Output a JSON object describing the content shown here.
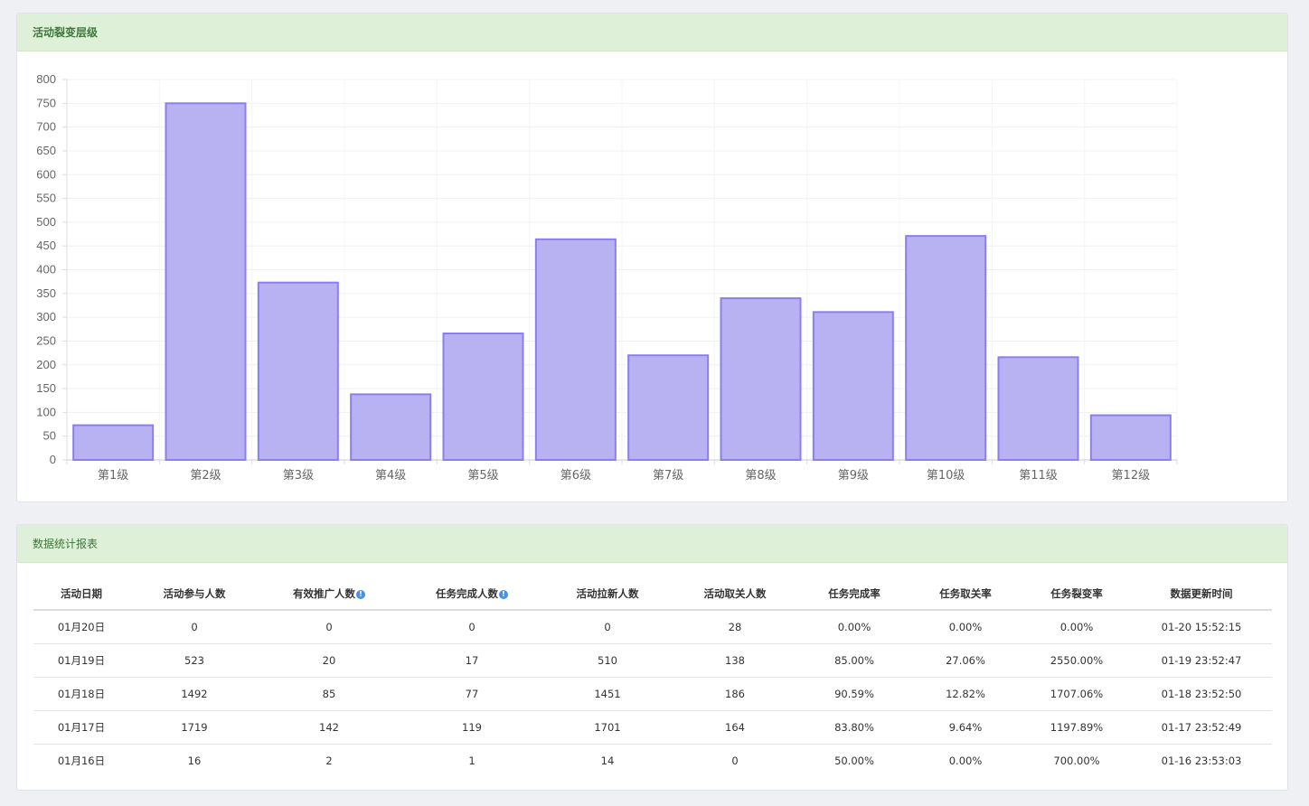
{
  "chart_panel": {
    "title": "活动裂变层级"
  },
  "table_panel": {
    "title": "数据统计报表"
  },
  "chart_data": {
    "type": "bar",
    "title": "",
    "xlabel": "",
    "ylabel": "",
    "categories": [
      "第1级",
      "第2级",
      "第3级",
      "第4级",
      "第5级",
      "第6级",
      "第7级",
      "第8级",
      "第9级",
      "第10级",
      "第11级",
      "第12级"
    ],
    "series": [
      {
        "values": [
          73,
          750,
          373,
          138,
          266,
          464,
          220,
          340,
          311,
          471,
          216,
          94
        ]
      }
    ],
    "ylim": [
      0,
      800
    ],
    "yticks": [
      0,
      50,
      100,
      150,
      200,
      250,
      300,
      350,
      400,
      450,
      500,
      550,
      600,
      650,
      700,
      750,
      800
    ],
    "grid": true,
    "colors": {
      "bar_fill": "#b8b2f3",
      "bar_stroke": "#8b7ff0"
    }
  },
  "table": {
    "headers": [
      {
        "label": "活动日期",
        "info": false
      },
      {
        "label": "活动参与人数",
        "info": false
      },
      {
        "label": "有效推广人数",
        "info": true
      },
      {
        "label": "任务完成人数",
        "info": true
      },
      {
        "label": "活动拉新人数",
        "info": false
      },
      {
        "label": "活动取关人数",
        "info": false
      },
      {
        "label": "任务完成率",
        "info": false
      },
      {
        "label": "任务取关率",
        "info": false
      },
      {
        "label": "任务裂变率",
        "info": false
      },
      {
        "label": "数据更新时间",
        "info": false
      }
    ],
    "rows": [
      [
        "01月20日",
        "0",
        "0",
        "0",
        "0",
        "28",
        "0.00%",
        "0.00%",
        "0.00%",
        "01-20 15:52:15"
      ],
      [
        "01月19日",
        "523",
        "20",
        "17",
        "510",
        "138",
        "85.00%",
        "27.06%",
        "2550.00%",
        "01-19 23:52:47"
      ],
      [
        "01月18日",
        "1492",
        "85",
        "77",
        "1451",
        "186",
        "90.59%",
        "12.82%",
        "1707.06%",
        "01-18 23:52:50"
      ],
      [
        "01月17日",
        "1719",
        "142",
        "119",
        "1701",
        "164",
        "83.80%",
        "9.64%",
        "1197.89%",
        "01-17 23:52:49"
      ],
      [
        "01月16日",
        "16",
        "2",
        "1",
        "14",
        "0",
        "50.00%",
        "0.00%",
        "700.00%",
        "01-16 23:53:03"
      ]
    ]
  }
}
